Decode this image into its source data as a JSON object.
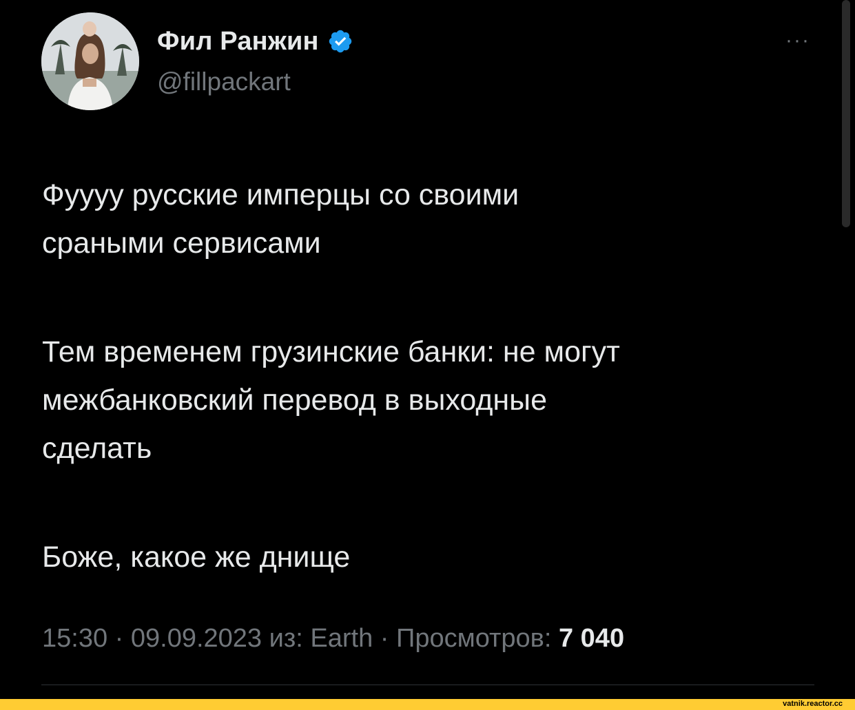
{
  "tweet": {
    "author": {
      "display_name": "Фил Ранжин",
      "handle": "@fillpackart",
      "verified": true,
      "avatar_icon": "profile-photo-icon",
      "verified_icon": "verified-badge-icon"
    },
    "more_menu": {
      "icon": "more-options-icon",
      "label": "···"
    },
    "paragraphs": [
      "Фуууу русские имперцы со своими\nсраными сервисами",
      "Тем временем грузинские банки: не могут\nмежбанковский перевод в выходные\nсделать",
      "Боже, какое же днище"
    ],
    "meta": {
      "time": "15:30",
      "separator": " · ",
      "date": "09.09.2023",
      "source": "из: Earth",
      "views_label": "Просмотров:",
      "views_count": "7 040"
    }
  },
  "watermark": {
    "text": "vatnik.reactor.cc"
  },
  "colors": {
    "background": "#000000",
    "primary_text": "#e7e9ea",
    "secondary_text": "#71767b",
    "verified_blue": "#1d9bf0",
    "watermark_bar": "#ffcc33"
  }
}
